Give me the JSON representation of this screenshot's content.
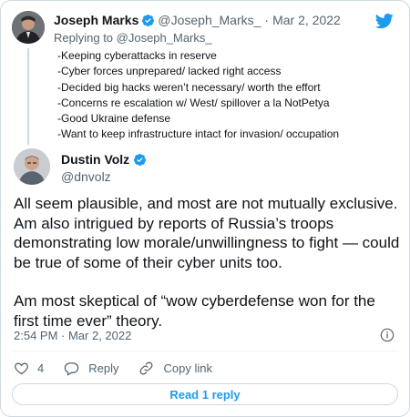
{
  "quoted": {
    "name": "Joseph Marks",
    "handle": "@Joseph_Marks_",
    "separator": "·",
    "date": "Mar 2, 2022",
    "replying_to": "Replying to @Joseph_Marks_",
    "lines": [
      "-Keeping cyberattacks in reserve",
      "-Cyber forces unprepared/ lacked right access",
      "-Decided big hacks weren’t necessary/ worth the effort",
      "-Concerns re escalation w/ West/ spillover a la NotPetya",
      "-Good Ukraine defense",
      "-Want to keep infrastructure intact for invasion/ occupation"
    ]
  },
  "tweet": {
    "name": "Dustin Volz",
    "handle": "@dnvolz",
    "paragraph1": "All seem plausible, and most are not mutually exclusive. Am also intrigued by reports of Russia’s troops demonstrating low morale/unwillingness to fight — could be true of some of their cyber units too.",
    "paragraph2": "Am most skeptical of “wow cyberdefense won for the first time ever” theory.",
    "timestamp": "2:54 PM · Mar 2, 2022"
  },
  "actions": {
    "like_count": "4",
    "reply_label": "Reply",
    "copy_link_label": "Copy link"
  },
  "read_replies_label": "Read 1 reply",
  "colors": {
    "accent": "#1d9bf0",
    "like": "#f91880",
    "text": "#0f1419",
    "muted": "#536471",
    "border": "#cfd9de"
  },
  "icons": [
    "twitter-bird-icon",
    "verified-badge-icon",
    "info-icon",
    "heart-icon",
    "reply-bubble-icon",
    "link-icon"
  ]
}
